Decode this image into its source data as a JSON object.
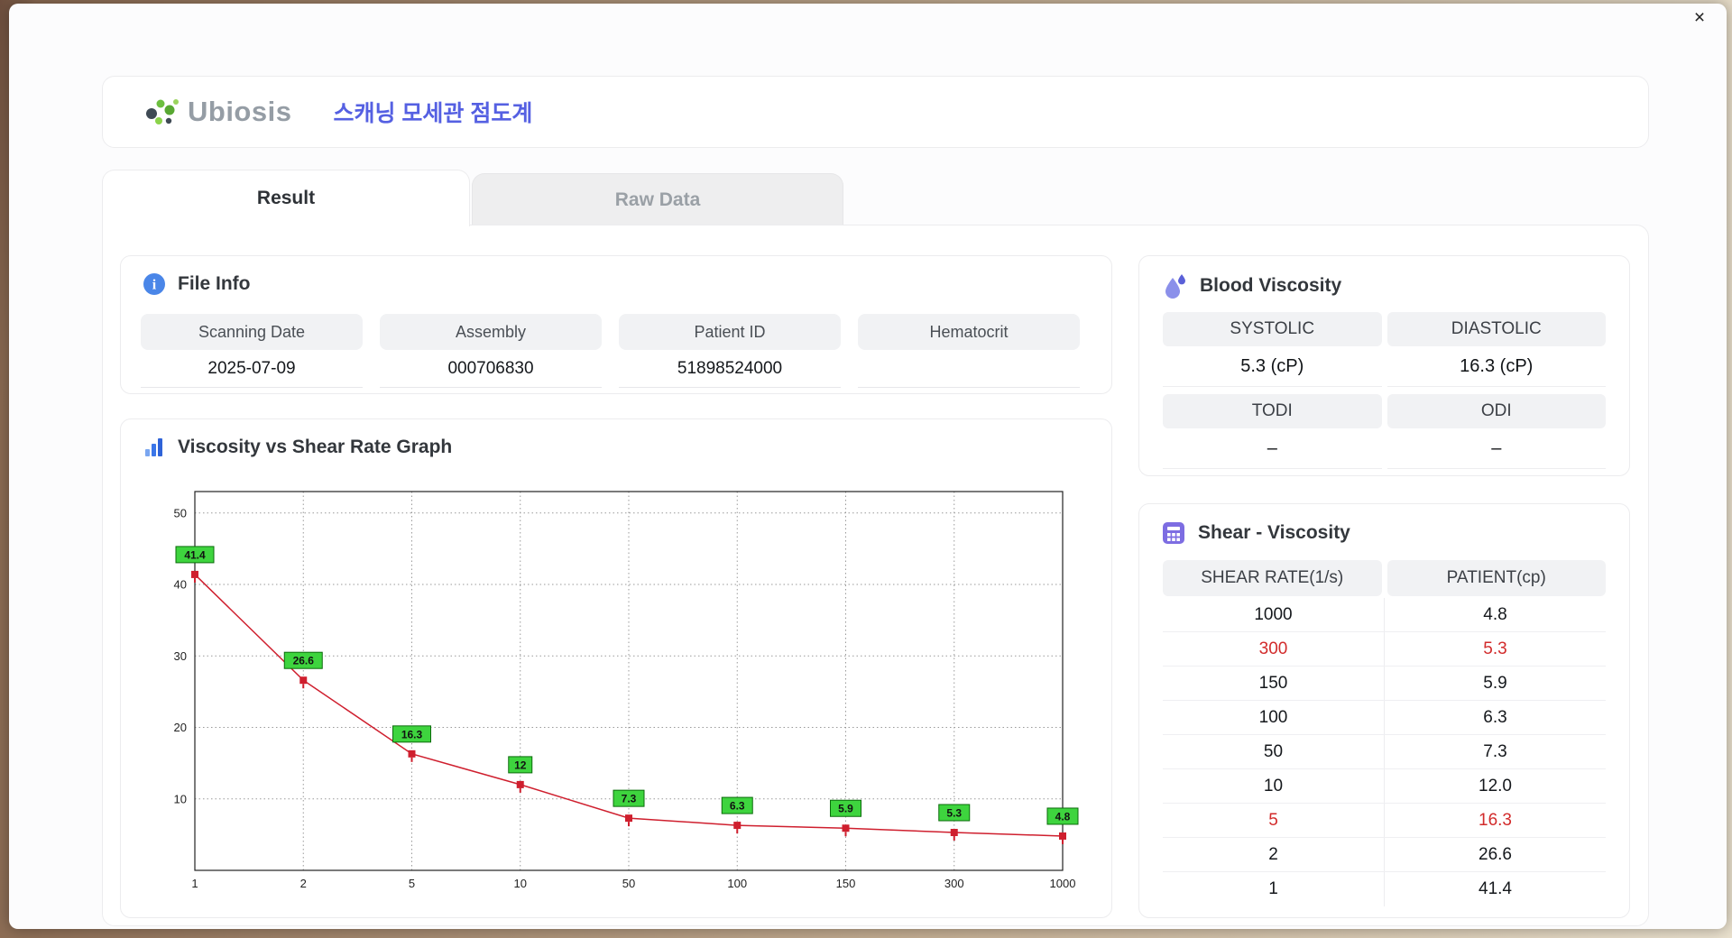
{
  "window": {
    "close": "×"
  },
  "header": {
    "logo_text": "Ubiosis",
    "title": "스캐닝 모세관 점도계"
  },
  "tabs": [
    {
      "label": "Result"
    },
    {
      "label": "Raw Data"
    }
  ],
  "file_info": {
    "title": "File Info",
    "fields": [
      {
        "label": "Scanning Date",
        "value": "2025-07-09"
      },
      {
        "label": "Assembly",
        "value": "000706830"
      },
      {
        "label": "Patient ID",
        "value": "51898524000"
      },
      {
        "label": "Hematocrit",
        "value": ""
      }
    ]
  },
  "graph": {
    "title": "Viscosity vs Shear Rate Graph"
  },
  "chart_data": {
    "type": "line",
    "title": "Viscosity vs Shear Rate Graph",
    "xlabel": "",
    "ylabel": "",
    "x_labels": [
      "1",
      "2",
      "5",
      "10",
      "50",
      "100",
      "150",
      "300",
      "1000"
    ],
    "values": [
      41.4,
      26.6,
      16.3,
      12,
      7.3,
      6.3,
      5.9,
      5.3,
      4.8
    ],
    "point_labels": [
      "41.4",
      "26.6",
      "16.3",
      "12",
      "7.3",
      "6.3",
      "5.9",
      "5.3",
      "4.8"
    ],
    "y_ticks": [
      10,
      20,
      30,
      40,
      50
    ],
    "ylim": [
      0,
      53
    ],
    "grid": "dotted",
    "line_color": "#cf1f2e",
    "label_bg": "#3ed43e",
    "label_border": "#0b6b0b"
  },
  "blood_viscosity": {
    "title": "Blood Viscosity",
    "headers": [
      "SYSTOLIC",
      "DIASTOLIC"
    ],
    "values": [
      "5.3 (cP)",
      "16.3 (cP)"
    ],
    "headers2": [
      "TODI",
      "ODI"
    ],
    "values2": [
      "–",
      "–"
    ]
  },
  "shear_table": {
    "title": "Shear - Viscosity",
    "columns": [
      "SHEAR RATE(1/s)",
      "PATIENT(cp)"
    ],
    "highlight_color": "#d22b2b",
    "rows": [
      {
        "shear": "1000",
        "patient": "4.8",
        "highlight": false
      },
      {
        "shear": "300",
        "patient": "5.3",
        "highlight": true
      },
      {
        "shear": "150",
        "patient": "5.9",
        "highlight": false
      },
      {
        "shear": "100",
        "patient": "6.3",
        "highlight": false
      },
      {
        "shear": "50",
        "patient": "7.3",
        "highlight": false
      },
      {
        "shear": "10",
        "patient": "12.0",
        "highlight": false
      },
      {
        "shear": "5",
        "patient": "16.3",
        "highlight": true
      },
      {
        "shear": "2",
        "patient": "26.6",
        "highlight": false
      },
      {
        "shear": "1",
        "patient": "41.4",
        "highlight": false
      }
    ]
  },
  "colors": {
    "accent_blue": "#5560e2",
    "logo_green": "#6cbf3f"
  }
}
